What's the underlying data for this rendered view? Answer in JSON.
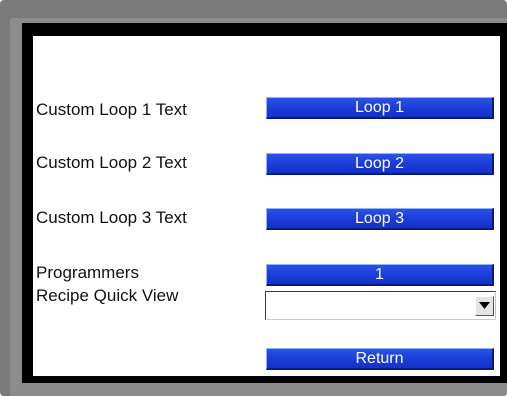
{
  "rows": [
    {
      "label": "Custom Loop 1 Text",
      "button": "Loop 1"
    },
    {
      "label": "Custom Loop 2 Text",
      "button": "Loop 2"
    },
    {
      "label": "Custom Loop 3 Text",
      "button": "Loop 3"
    }
  ],
  "programmers": {
    "label": "Programmers",
    "value": "1"
  },
  "recipe_quick_view": {
    "label": "Recipe Quick View",
    "selected": "",
    "icon": "chevron-down-icon"
  },
  "return_button": "Return",
  "colors": {
    "button_blue": "#1a3bd8",
    "bezel_gray": "#8c8c8c",
    "frame_black": "#000000"
  }
}
